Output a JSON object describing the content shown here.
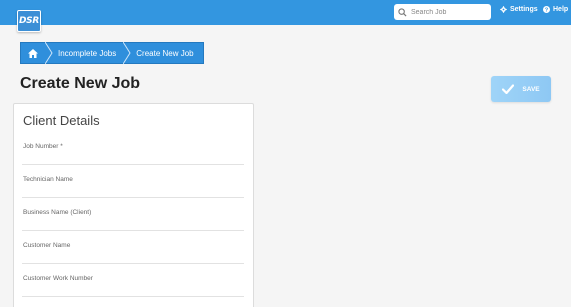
{
  "header": {
    "logo_text": "DSR",
    "search_placeholder": "Search Job",
    "settings_label": "Settings",
    "help_label": "Help",
    "bar_color": "#3396e0"
  },
  "breadcrumb": {
    "home_icon": "home-icon",
    "items": [
      {
        "label": "Incomplete Jobs"
      },
      {
        "label": "Create New Job"
      }
    ]
  },
  "page": {
    "title": "Create New Job",
    "save_label": "SAVE"
  },
  "client_details": {
    "title": "Client Details",
    "fields": [
      {
        "label": "Job Number *",
        "value": ""
      },
      {
        "label": "Technician Name",
        "value": ""
      },
      {
        "label": "Business Name (Client)",
        "value": ""
      },
      {
        "label": "Customer Name",
        "value": ""
      },
      {
        "label": "Customer Work Number",
        "value": ""
      }
    ]
  }
}
